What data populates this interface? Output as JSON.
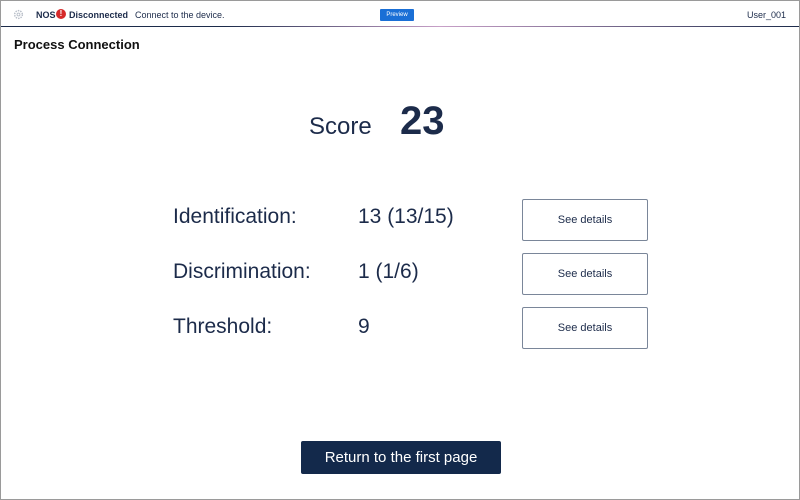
{
  "topbar": {
    "settings_icon": "gear-icon",
    "device_name": "NOS",
    "alert_icon": "!",
    "connection_status": "Disconnected",
    "message": "Connect to the device.",
    "preview_badge": "Preview",
    "user": "User_001"
  },
  "page": {
    "title": "Process Connection"
  },
  "score": {
    "label": "Score",
    "value": "23"
  },
  "results": [
    {
      "label": "Identification:",
      "value": "13 (13/15)",
      "button": "See details"
    },
    {
      "label": "Discrimination:",
      "value": "1 (1/6)",
      "button": "See details"
    },
    {
      "label": "Threshold:",
      "value": "9",
      "button": "See details"
    }
  ],
  "actions": {
    "return_label": "Return to the first page"
  },
  "colors": {
    "navy": "#13294b",
    "text": "#1c2b4a",
    "alert": "#d62a2a",
    "preview": "#1a6fd6"
  }
}
